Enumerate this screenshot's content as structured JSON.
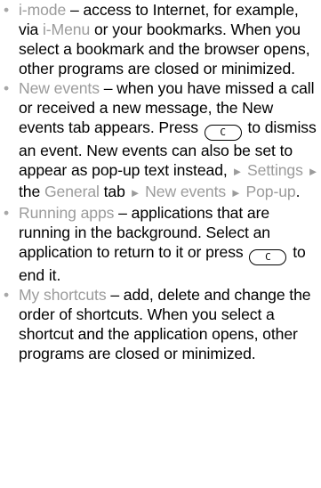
{
  "items": [
    {
      "term": "i-mode",
      "t1": " – access to Internet, for example, via ",
      "link": "i-Menu",
      "t2": " or your bookmarks. When you select a bookmark and the browser opens, other programs are closed or minimized."
    },
    {
      "term": "New events",
      "t1": " – when you have missed a call or received a new message, the New events tab appears. Press ",
      "key": "C",
      "t2": " to dismiss an event. New events can also be set to appear as pop-up text instead, ",
      "path1": "Settings",
      "t3": " the ",
      "path2": "General",
      "t4": " tab ",
      "path3": "New events",
      "path4": "Pop-up",
      "t5": "."
    },
    {
      "term": "Running apps",
      "t1": " – applications that are running in the background. Select an application to return to it or press ",
      "key": "C",
      "t2": " to end it."
    },
    {
      "term": "My shortcuts",
      "t1": " – add, delete and change the order of shortcuts. When you select a shortcut and the application opens, other programs are closed or minimized."
    }
  ],
  "arrow_glyph": "►",
  "bullet_glyph": "•"
}
